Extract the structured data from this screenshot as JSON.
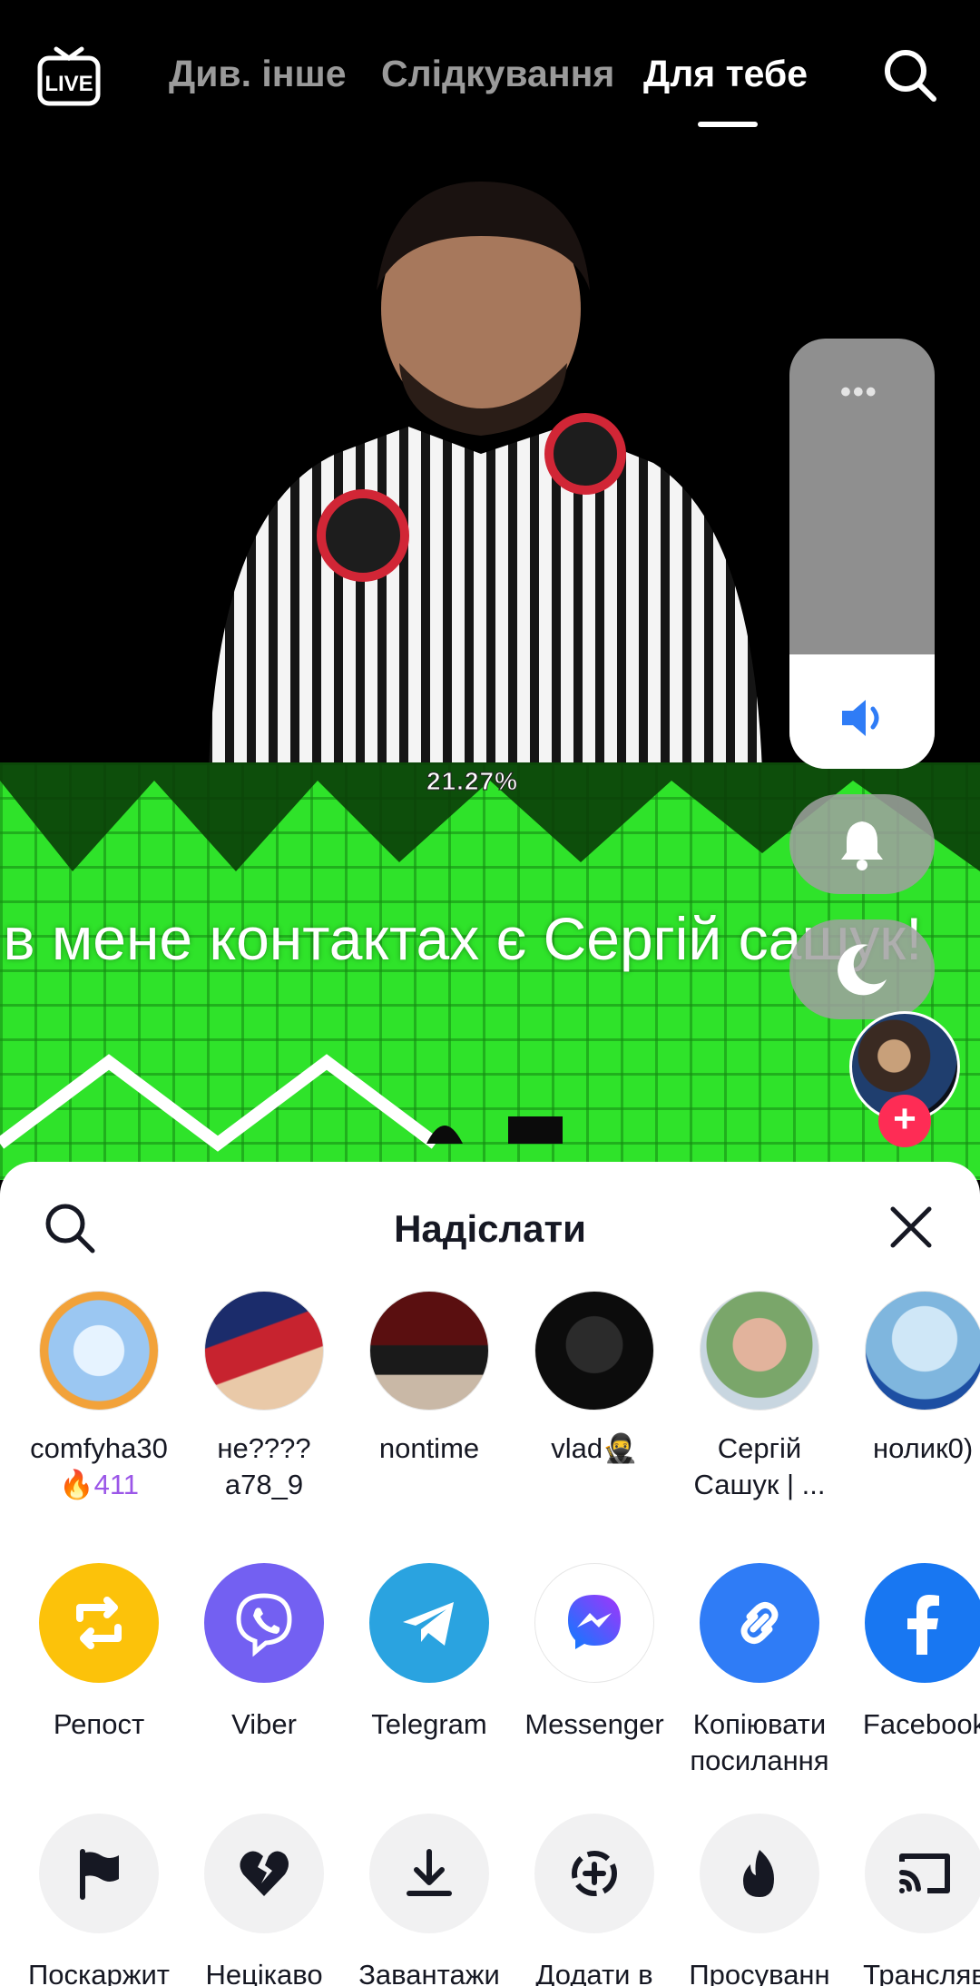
{
  "topnav": {
    "live_label": "LIVE",
    "tabs": [
      "Див. інше",
      "Слідкування",
      "Для тебе"
    ],
    "active_tab": "Для тебе"
  },
  "video": {
    "progress_text": "21.27%",
    "subtitle": "в мене контактах є Сергій сашук!"
  },
  "share_sheet": {
    "title": "Надіслати",
    "contacts": [
      {
        "name": "comfyha30",
        "streak": "411"
      },
      {
        "name": "не????\na78_9"
      },
      {
        "name": "nontime"
      },
      {
        "name": "vlad🥷"
      },
      {
        "name": "Сергій\nСашук | ..."
      },
      {
        "name": "нолик0)"
      }
    ],
    "apps": [
      {
        "label": "Репост",
        "icon": "repost-icon",
        "color": "#fcc20a"
      },
      {
        "label": "Viber",
        "icon": "viber-icon",
        "color": "#7360f2"
      },
      {
        "label": "Telegram",
        "icon": "telegram-icon",
        "color": "#2aa3e0"
      },
      {
        "label": "Messenger",
        "icon": "messenger-icon",
        "color": "#1877f2"
      },
      {
        "label": "Копіювати\nпосилання",
        "icon": "link-icon",
        "color": "#2f7cf6"
      },
      {
        "label": "Facebook",
        "icon": "facebook-icon",
        "color": "#1877f2"
      }
    ],
    "actions": [
      {
        "label": "Поскаржит",
        "icon": "flag-icon"
      },
      {
        "label": "Нецікаво",
        "icon": "broken-heart-icon"
      },
      {
        "label": "Завантажи",
        "icon": "download-icon"
      },
      {
        "label": "Додати в",
        "icon": "add-to-icon"
      },
      {
        "label": "Просуванн",
        "icon": "fire-icon"
      },
      {
        "label": "Трансляв",
        "icon": "cast-icon"
      }
    ]
  },
  "colors": {
    "accent_red": "#fe2c55",
    "game_green": "#2fe32a"
  }
}
